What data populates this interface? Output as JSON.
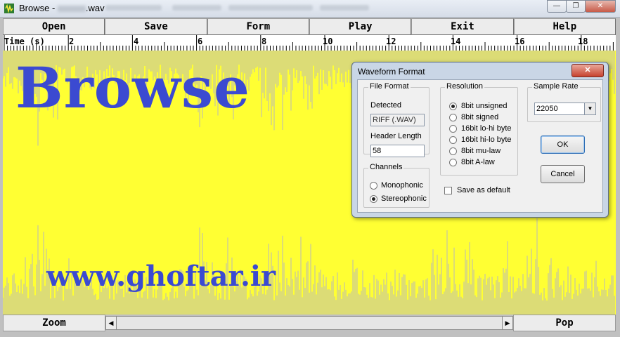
{
  "window": {
    "title": "Browse - ",
    "title_file": ".wav",
    "minimize": "—",
    "maximize": "❐",
    "close": "✕"
  },
  "menu": {
    "open": "Open",
    "save": "Save",
    "form": "Form",
    "play": "Play",
    "exit": "Exit",
    "help": "Help"
  },
  "ruler": {
    "label": "Time (s)",
    "ticks": [
      "2",
      "4",
      "6",
      "8",
      "10",
      "12",
      "14",
      "16",
      "18"
    ]
  },
  "watermark": {
    "big": "Browse",
    "url": "www.ghoftar.ir"
  },
  "colors": {
    "waveform_bg": "#ffff33",
    "waveform_lines": "#b8b8b8",
    "watermark": "#3b4ad1"
  },
  "bottom": {
    "zoom": "Zoom",
    "pop": "Pop",
    "scroll_left": "◀",
    "scroll_right": "▶"
  },
  "dialog": {
    "title": "Waveform Format",
    "close": "✕",
    "file_format": {
      "group": "File Format",
      "detected_label": "Detected",
      "detected_value": "RIFF (.WAV)",
      "header_label": "Header Length",
      "header_value": "58"
    },
    "channels": {
      "group": "Channels",
      "options": [
        "Monophonic",
        "Stereophonic"
      ],
      "selected": "Stereophonic"
    },
    "resolution": {
      "group": "Resolution",
      "options": [
        "8bit unsigned",
        "8bit signed",
        "16bit lo-hi byte",
        "16bit hi-lo byte",
        "8bit mu-law",
        "8bit A-law"
      ],
      "selected": "8bit unsigned"
    },
    "sample_rate": {
      "group": "Sample Rate",
      "value": "22050"
    },
    "save_default": "Save as default",
    "ok": "OK",
    "cancel": "Cancel"
  }
}
